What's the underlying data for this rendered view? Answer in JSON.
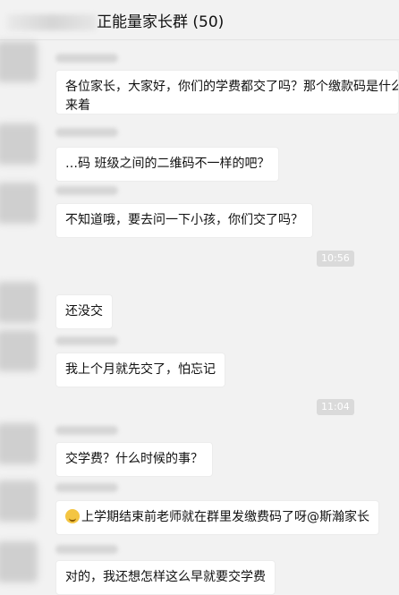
{
  "header": {
    "title": "正能量家长群 (50)"
  },
  "messages": [
    {
      "text": "各位家长，大家好，你们的学费都交了吗？那个缴款码是什么来着"
    },
    {
      "text": "…码 班级之间的二维码不一样的吧？"
    },
    {
      "text": "不知道哦，要去问一下小孩，你们交了吗？"
    },
    {
      "text": "还没交"
    },
    {
      "text": "我上个月就先交了，怕忘记"
    },
    {
      "text": "交学费？什么时候的事？"
    },
    {
      "text": "上学期结束前老师就在群里发缴费码了呀@斯瀚家长",
      "icon": "laughing-emoji-icon"
    },
    {
      "text": "对的，我还想怎样这么早就要交学费"
    }
  ],
  "times": [
    "10:56",
    "11:04"
  ]
}
